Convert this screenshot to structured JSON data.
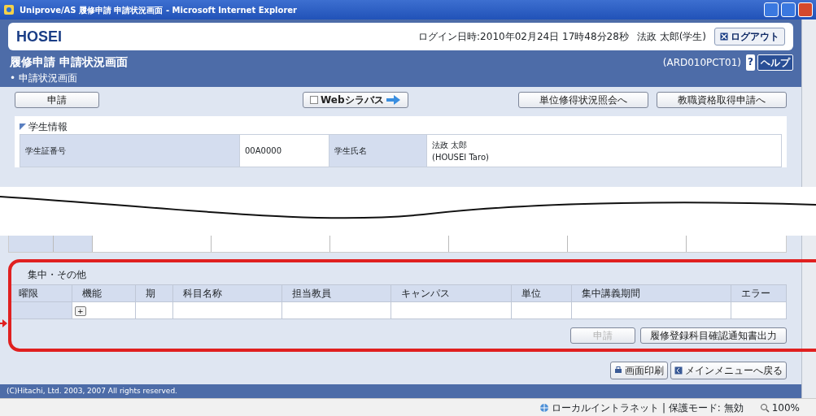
{
  "window": {
    "title": "Uniprove/AS 履修申請 申請状況画面 - Microsoft Internet Explorer"
  },
  "header": {
    "logo": "HOSEI",
    "login_time": "ログイン日時:2010年02月24日 17時48分28秒",
    "user": "法政 太郎(学生)",
    "logout": "ログアウト"
  },
  "page": {
    "title": "履修申請 申請状況画面",
    "screen_id": "(ARD010PCT01)",
    "help_mark": "?",
    "help": "ヘルプ",
    "breadcrumb": "• 申請状況画面"
  },
  "buttons": [
    {
      "label": "申請",
      "kind": "plain"
    },
    {
      "label": "Webシラバス",
      "kind": "syllabus"
    },
    {
      "label": "単位修得状況照会へ",
      "kind": "plain"
    },
    {
      "label": "教職資格取得申請へ",
      "kind": "plain"
    }
  ],
  "student_section": {
    "title": "学生情報",
    "fields": [
      {
        "label": "学生証番号",
        "value": [
          "00A0000"
        ]
      },
      {
        "label": "学生氏名",
        "value": [
          "法政 太郎",
          "(HOUSEI Taro)"
        ]
      }
    ]
  },
  "other_section": {
    "title": "集中・その他",
    "columns": [
      "曜限",
      "機能",
      "期",
      "科目名称",
      "担当教員",
      "キャンパス",
      "単位",
      "集中講義期間",
      "エラー"
    ],
    "add_button": "+"
  },
  "actions": [
    {
      "label": "申請",
      "disabled": true
    },
    {
      "label": "履修登録科目確認通知書出力",
      "disabled": false
    }
  ],
  "footer_buttons": [
    {
      "label": "画面印刷",
      "kind": "print"
    },
    {
      "label": "メインメニューへ戻る",
      "kind": "menu"
    }
  ],
  "copyright": "(C)Hitachi, Ltd. 2003, 2007 All rights reserved.",
  "status_bar": {
    "zone": "ローカルイントラネット | 保護モード: 無効",
    "zoom": "100%"
  }
}
